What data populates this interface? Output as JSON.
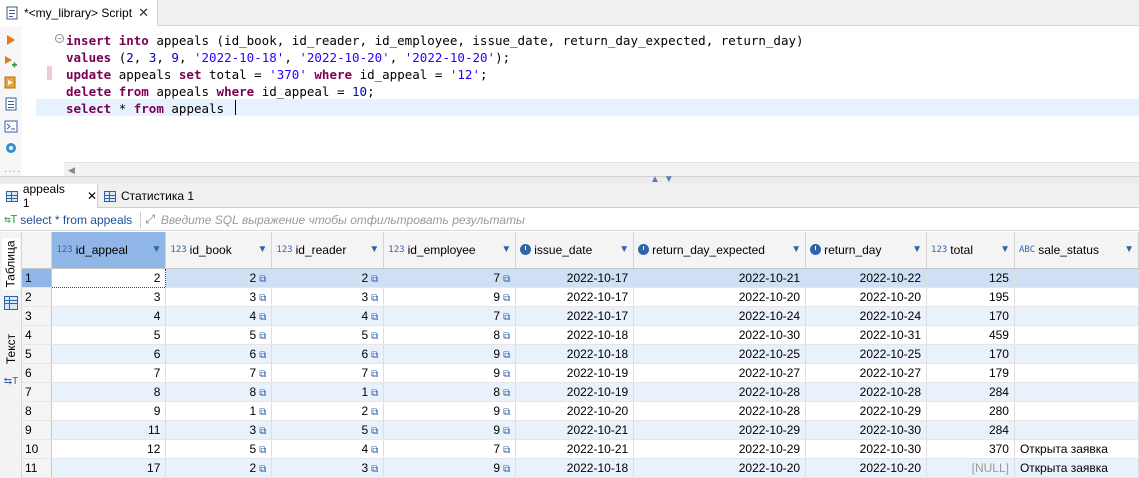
{
  "editor_tab": {
    "title": "*<my_library> Script",
    "close": "✕"
  },
  "code_lines": [
    [
      {
        "t": "insert ",
        "c": "kw"
      },
      {
        "t": "into ",
        "c": "kw"
      },
      {
        "t": "appeals (id_book, id_reader, id_employee, issue_date, return_day_expected, return_day)",
        "c": "plain"
      }
    ],
    [
      {
        "t": "values ",
        "c": "kw"
      },
      {
        "t": "(",
        "c": "plain"
      },
      {
        "t": "2",
        "c": "num"
      },
      {
        "t": ", ",
        "c": "plain"
      },
      {
        "t": "3",
        "c": "num"
      },
      {
        "t": ", ",
        "c": "plain"
      },
      {
        "t": "9",
        "c": "num"
      },
      {
        "t": ", ",
        "c": "plain"
      },
      {
        "t": "'2022-10-18'",
        "c": "str"
      },
      {
        "t": ", ",
        "c": "plain"
      },
      {
        "t": "'2022-10-20'",
        "c": "str"
      },
      {
        "t": ", ",
        "c": "plain"
      },
      {
        "t": "'2022-10-20'",
        "c": "str"
      },
      {
        "t": ");",
        "c": "plain"
      }
    ],
    [
      {
        "t": "update ",
        "c": "kw"
      },
      {
        "t": "appeals ",
        "c": "plain"
      },
      {
        "t": "set ",
        "c": "kw"
      },
      {
        "t": "total = ",
        "c": "plain"
      },
      {
        "t": "'370'",
        "c": "str"
      },
      {
        "t": " ",
        "c": "plain"
      },
      {
        "t": "where ",
        "c": "kw"
      },
      {
        "t": "id_appeal = ",
        "c": "plain"
      },
      {
        "t": "'12'",
        "c": "str"
      },
      {
        "t": ";",
        "c": "plain"
      }
    ],
    [
      {
        "t": "delete ",
        "c": "kw"
      },
      {
        "t": "from ",
        "c": "kw"
      },
      {
        "t": "appeals ",
        "c": "plain"
      },
      {
        "t": "where ",
        "c": "kw"
      },
      {
        "t": "id_appeal = ",
        "c": "plain"
      },
      {
        "t": "10",
        "c": "num"
      },
      {
        "t": ";",
        "c": "plain"
      }
    ],
    [
      {
        "t": "select ",
        "c": "kw"
      },
      {
        "t": "* ",
        "c": "plain"
      },
      {
        "t": "from ",
        "c": "kw"
      },
      {
        "t": "appeals",
        "c": "plain"
      }
    ]
  ],
  "result_tabs": [
    {
      "label": "appeals 1",
      "close": "✕"
    },
    {
      "label": "Статистика 1"
    }
  ],
  "filter": {
    "query": "select * from appeals",
    "placeholder": "Введите SQL выражение чтобы отфильтровать результаты"
  },
  "side_tabs": {
    "table": "Таблица",
    "text": "Текст"
  },
  "columns": [
    {
      "name": "id_appeal",
      "type": "123",
      "icon": "number-key-icon"
    },
    {
      "name": "id_book",
      "type": "123",
      "icon": "number-fk-icon"
    },
    {
      "name": "id_reader",
      "type": "123",
      "icon": "number-fk-icon"
    },
    {
      "name": "id_employee",
      "type": "123",
      "icon": "number-fk-icon"
    },
    {
      "name": "issue_date",
      "type": "",
      "icon": "clock-icon"
    },
    {
      "name": "return_day_expected",
      "type": "",
      "icon": "clock-icon"
    },
    {
      "name": "return_day",
      "type": "",
      "icon": "clock-icon"
    },
    {
      "name": "total",
      "type": "123",
      "icon": "number-icon"
    },
    {
      "name": "sale_status",
      "type": "ABC",
      "icon": "text-icon"
    }
  ],
  "rows": [
    [
      "1",
      "2",
      "2",
      "2",
      "7",
      "2022-10-17",
      "2022-10-21",
      "2022-10-22",
      "125",
      ""
    ],
    [
      "2",
      "3",
      "3",
      "3",
      "9",
      "2022-10-17",
      "2022-10-20",
      "2022-10-20",
      "195",
      ""
    ],
    [
      "3",
      "4",
      "4",
      "4",
      "7",
      "2022-10-17",
      "2022-10-24",
      "2022-10-24",
      "170",
      ""
    ],
    [
      "4",
      "5",
      "5",
      "5",
      "8",
      "2022-10-18",
      "2022-10-30",
      "2022-10-31",
      "459",
      ""
    ],
    [
      "5",
      "6",
      "6",
      "6",
      "9",
      "2022-10-18",
      "2022-10-25",
      "2022-10-25",
      "170",
      ""
    ],
    [
      "6",
      "7",
      "7",
      "7",
      "9",
      "2022-10-19",
      "2022-10-27",
      "2022-10-27",
      "179",
      ""
    ],
    [
      "7",
      "8",
      "8",
      "1",
      "8",
      "2022-10-19",
      "2022-10-28",
      "2022-10-28",
      "284",
      ""
    ],
    [
      "8",
      "9",
      "1",
      "2",
      "9",
      "2022-10-20",
      "2022-10-28",
      "2022-10-29",
      "280",
      ""
    ],
    [
      "9",
      "11",
      "3",
      "5",
      "9",
      "2022-10-21",
      "2022-10-29",
      "2022-10-30",
      "284",
      ""
    ],
    [
      "10",
      "12",
      "5",
      "4",
      "7",
      "2022-10-21",
      "2022-10-29",
      "2022-10-30",
      "370",
      "Открыта заявка"
    ],
    [
      "11",
      "17",
      "2",
      "3",
      "9",
      "2022-10-18",
      "2022-10-20",
      "2022-10-20",
      "[NULL]",
      "Открыта заявка"
    ]
  ],
  "colors": {
    "accent": "#2f65a8",
    "selection": "#8fb6e6",
    "keyword": "#7b0052",
    "string": "#2a00ff"
  }
}
